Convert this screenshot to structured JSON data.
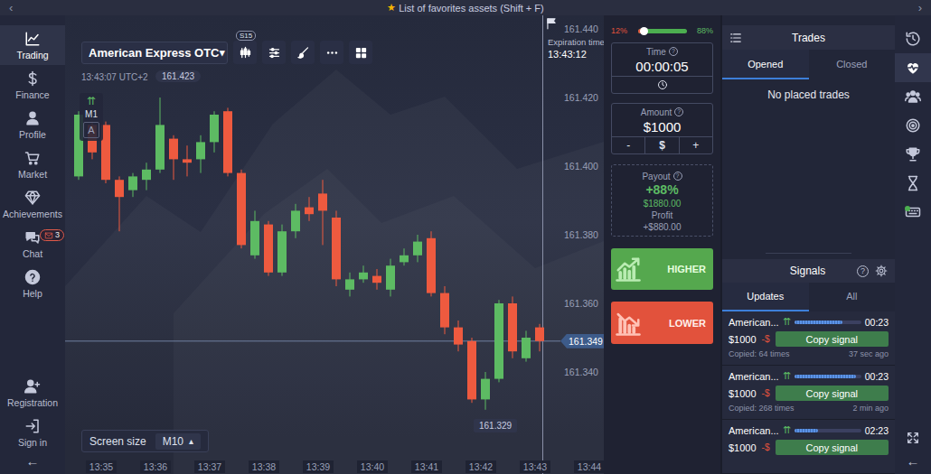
{
  "top_bar": {
    "prev": "‹",
    "star": "★",
    "title": "List of favorites assets (Shift + F)",
    "next": "›"
  },
  "sidebar": {
    "items": [
      {
        "label": "Trading",
        "selected": true
      },
      {
        "label": "Finance",
        "selected": false
      },
      {
        "label": "Profile",
        "selected": false
      },
      {
        "label": "Market",
        "selected": false
      },
      {
        "label": "Achievements",
        "selected": false
      },
      {
        "label": "Chat",
        "selected": false,
        "badge": "3"
      },
      {
        "label": "Help",
        "selected": false
      }
    ],
    "bottom_items": [
      {
        "label": "Registration"
      },
      {
        "label": "Sign in"
      }
    ],
    "collapse": "←"
  },
  "chart": {
    "asset": "American Express OTC",
    "asset_caret": "▾",
    "period_badge": "S15",
    "clock": "13:43:07 UTC+2",
    "cursor_price": "161.423",
    "indicator": {
      "arrows": "⇈",
      "timeframe": "M1",
      "label": "A"
    },
    "expiration": {
      "label": "Expiration time",
      "time": "13:43:12"
    },
    "price_ticks": [
      {
        "label": "161.440",
        "value": 161.44
      },
      {
        "label": "161.420",
        "value": 161.42
      },
      {
        "label": "161.400",
        "value": 161.4
      },
      {
        "label": "161.380",
        "value": 161.38
      },
      {
        "label": "161.360",
        "value": 161.36
      },
      {
        "label": "161.340",
        "value": 161.34
      }
    ],
    "time_ticks": [
      "13:35",
      "13:36",
      "13:37",
      "13:38",
      "13:39",
      "13:40",
      "13:41",
      "13:42",
      "13:43",
      "13:44"
    ],
    "current_price": {
      "label": "161.349",
      "value": 161.349
    },
    "low_marker": {
      "label": "161.329",
      "value": 161.329
    },
    "series": {
      "open": [
        161.397,
        161.412,
        161.412,
        161.396,
        161.393,
        161.396,
        161.399,
        161.408,
        161.402,
        161.402,
        161.407,
        161.416,
        161.398,
        161.374,
        161.383,
        161.369,
        161.381,
        161.388,
        161.392,
        161.385,
        161.364,
        161.367,
        161.368,
        161.364,
        161.372,
        161.374,
        161.379,
        161.363,
        161.353,
        161.349,
        161.332,
        161.338,
        161.36,
        161.344,
        161.353
      ],
      "high": [
        161.416,
        161.413,
        161.413,
        161.397,
        161.398,
        161.401,
        161.42,
        161.409,
        161.406,
        161.409,
        161.416,
        161.417,
        161.399,
        161.387,
        161.384,
        161.383,
        161.389,
        161.391,
        161.396,
        161.387,
        161.369,
        161.371,
        161.37,
        161.373,
        161.376,
        161.38,
        161.381,
        161.365,
        161.355,
        161.35,
        161.34,
        161.361,
        161.362,
        161.352,
        161.354
      ],
      "low": [
        161.396,
        161.402,
        161.395,
        161.381,
        161.391,
        161.393,
        161.398,
        161.396,
        161.397,
        161.398,
        161.404,
        161.397,
        161.376,
        161.373,
        161.368,
        161.368,
        161.379,
        161.384,
        161.377,
        161.365,
        161.362,
        161.366,
        161.364,
        161.362,
        161.371,
        161.372,
        161.362,
        161.351,
        161.346,
        161.331,
        161.329,
        161.337,
        161.344,
        161.343,
        161.346
      ],
      "close": [
        161.415,
        161.404,
        161.396,
        161.391,
        161.397,
        161.399,
        161.412,
        161.402,
        161.401,
        161.407,
        161.415,
        161.398,
        161.377,
        161.384,
        161.369,
        161.381,
        161.387,
        161.386,
        161.387,
        161.367,
        161.367,
        161.369,
        161.366,
        161.371,
        161.374,
        161.378,
        161.363,
        161.353,
        161.348,
        161.332,
        161.338,
        161.36,
        161.346,
        161.35,
        161.349
      ]
    },
    "screen_size": {
      "label": "Screen size",
      "value": "M10",
      "caret": "▴"
    }
  },
  "deal": {
    "sentiment": {
      "low": "12%",
      "high": "88%",
      "level": 0.12
    },
    "time": {
      "label": "Time",
      "info": "?",
      "value": "00:00:05"
    },
    "amount": {
      "label": "Amount",
      "info": "?",
      "value": "$1000",
      "minus": "-",
      "currency": "$",
      "plus": "+"
    },
    "payout": {
      "label": "Payout",
      "info": "?",
      "percent": "+88%",
      "total": "$1880.00",
      "profit_label": "Profit",
      "profit": "+$880.00"
    },
    "higher": "HIGHER",
    "lower": "LOWER"
  },
  "trades": {
    "title": "Trades",
    "tabs": [
      {
        "label": "Opened",
        "selected": true
      },
      {
        "label": "Closed",
        "selected": false
      }
    ],
    "empty": "No placed trades"
  },
  "signals": {
    "title": "Signals",
    "help": "?",
    "tabs": [
      {
        "label": "Updates",
        "selected": true
      },
      {
        "label": "All",
        "selected": false
      }
    ],
    "items": [
      {
        "asset": "American...",
        "arrows": "⇈",
        "countdown": "00:23",
        "level": 0.72,
        "amount": "$1000",
        "change": "-$",
        "action": "Copy signal",
        "copied": "Copied: 64 times",
        "ago": "37 sec ago"
      },
      {
        "asset": "American...",
        "arrows": "⇈",
        "countdown": "00:23",
        "level": 0.92,
        "amount": "$1000",
        "change": "-$",
        "action": "Copy signal",
        "copied": "Copied: 268 times",
        "ago": "2 min ago"
      },
      {
        "asset": "American...",
        "arrows": "⇈",
        "countdown": "02:23",
        "level": 0.35,
        "amount": "$1000",
        "change": "-$",
        "action": "Copy signal"
      }
    ]
  },
  "right_rail": {
    "items": [
      {
        "selected": false,
        "dot": false
      },
      {
        "selected": true,
        "dot": false
      },
      {
        "selected": false,
        "dot": false
      },
      {
        "selected": false,
        "dot": false
      },
      {
        "selected": false,
        "dot": false
      },
      {
        "selected": false,
        "dot": false
      },
      {
        "selected": false,
        "dot": true
      }
    ],
    "collapse": "←"
  }
}
